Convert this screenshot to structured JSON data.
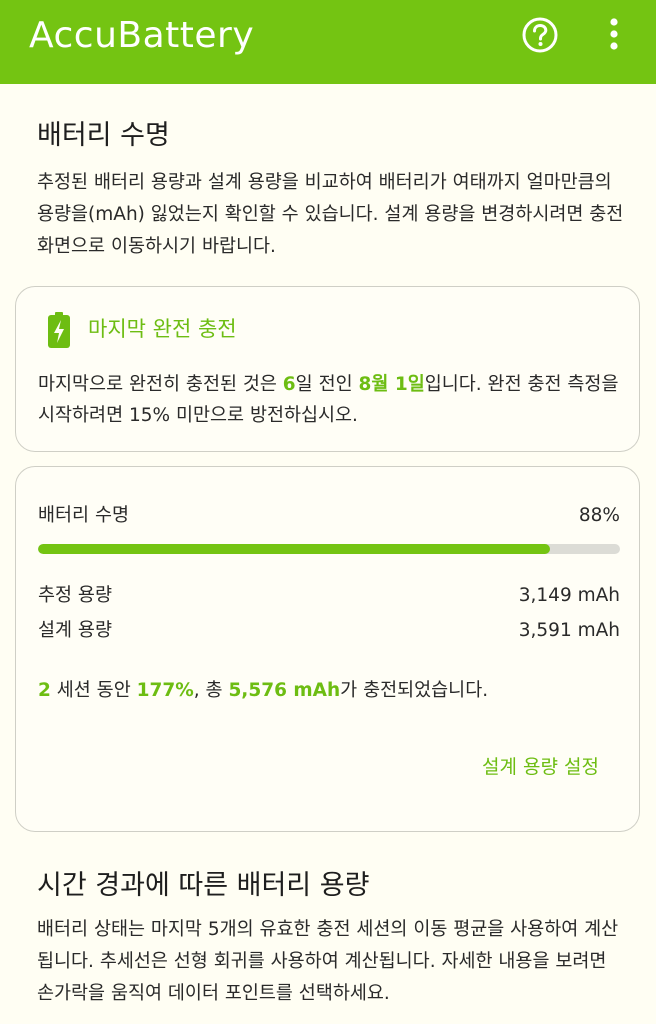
{
  "app_bar": {
    "title": "AccuBattery",
    "help_icon": "help-circle-icon",
    "more_icon": "more-vert-icon",
    "color": "#74C412"
  },
  "battery_health": {
    "title": "배터리 수명",
    "description": "추정된 배터리 용량과 설계 용량을 비교하여 배터리가 여태까지 얼마만큼의 용량을(mAh) 잃었는지 확인할 수 있습니다. 설계 용량을 변경하시려면 충전 화면으로 이동하시기 바랍니다."
  },
  "full_charge_card": {
    "icon": "battery-charging-icon",
    "title": "마지막 완전 충전",
    "text_part1": "마지막으로 완전히 충전된 것은 ",
    "days": "6",
    "text_part2": "일 전인 ",
    "date": "8월 1일",
    "text_part3": "입니다. 완전 충전 측정을 시작하려면 15% 미만으로 방전하십시오."
  },
  "health_card": {
    "health_label": "배터리 수명",
    "health_value": "88%",
    "health_percent": 88,
    "estimated_label": "추정 용량",
    "estimated_value": "3,149 mAh",
    "design_label": "설계 용량",
    "design_value": "3,591 mAh",
    "summary_sessions": "2",
    "summary_part1": " 세션 동안 ",
    "summary_percent": "177%",
    "summary_part2": ", 총 ",
    "summary_mah": "5,576 mAh",
    "summary_part3": "가 충전되었습니다.",
    "design_button": "설계 용량 설정"
  },
  "capacity_over_time": {
    "title": "시간 경과에 따른 배터리 용량",
    "description": "배터리 상태는 마지막 5개의 유효한 충전 세션의 이동 평균을 사용하여 계산됩니다. 추세선은 선형 회귀를 사용하여 계산됩니다. 자세한 내용을 보려면 손가락을 움직여 데이터 포인트를 선택하세요."
  },
  "colors": {
    "accent": "#74C412",
    "accent_text": "#6DBD12",
    "track": "#DCDCD6"
  }
}
